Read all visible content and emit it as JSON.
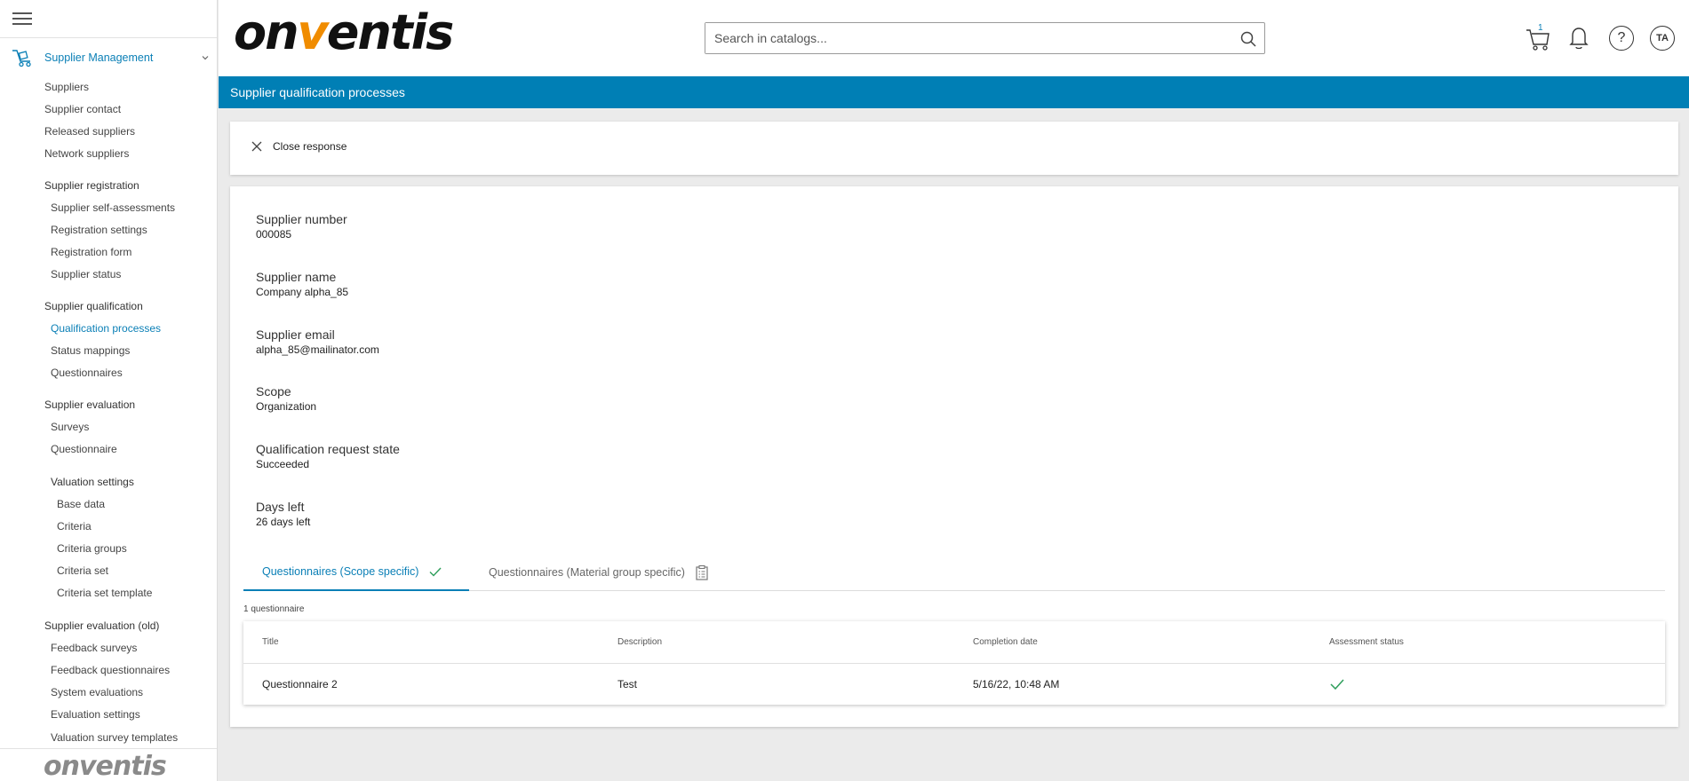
{
  "sidebar": {
    "section_label": "Supplier Management",
    "items": [
      {
        "label": "Suppliers"
      },
      {
        "label": "Supplier contact"
      },
      {
        "label": "Released suppliers"
      },
      {
        "label": "Network suppliers"
      },
      {
        "label": "Supplier registration"
      },
      {
        "label": "Supplier self-assessments"
      },
      {
        "label": "Registration settings"
      },
      {
        "label": "Registration form"
      },
      {
        "label": "Supplier status"
      },
      {
        "label": "Supplier qualification"
      },
      {
        "label": "Qualification processes"
      },
      {
        "label": "Status mappings"
      },
      {
        "label": "Questionnaires"
      },
      {
        "label": "Supplier evaluation"
      },
      {
        "label": "Surveys"
      },
      {
        "label": "Questionnaire"
      },
      {
        "label": "Valuation settings"
      },
      {
        "label": "Base data"
      },
      {
        "label": "Criteria"
      },
      {
        "label": "Criteria groups"
      },
      {
        "label": "Criteria set"
      },
      {
        "label": "Criteria set template"
      },
      {
        "label": "Supplier evaluation (old)"
      },
      {
        "label": "Feedback surveys"
      },
      {
        "label": "Feedback questionnaires"
      },
      {
        "label": "System evaluations"
      },
      {
        "label": "Evaluation settings"
      },
      {
        "label": "Valuation survey templates"
      }
    ],
    "footer_logo": "onventis"
  },
  "header": {
    "logo_left": "on",
    "logo_v": "v",
    "logo_right": "entis",
    "search_placeholder": "Search in catalogs...",
    "cart_count": "1",
    "help_symbol": "?",
    "avatar_initials": "TA"
  },
  "page_title": "Supplier qualification processes",
  "close_label": "Close response",
  "details": [
    {
      "label": "Supplier number",
      "value": "000085"
    },
    {
      "label": "Supplier name",
      "value": "Company alpha_85"
    },
    {
      "label": "Supplier email",
      "value": "alpha_85@mailinator.com"
    },
    {
      "label": "Scope",
      "value": "Organization"
    },
    {
      "label": "Qualification request state",
      "value": "Succeeded"
    },
    {
      "label": "Days left",
      "value": "26 days left"
    }
  ],
  "tabs": [
    {
      "label": "Questionnaires (Scope specific)",
      "icon": "checkmark-icon",
      "active": true
    },
    {
      "label": "Questionnaires (Material group specific)",
      "icon": "clipboard-icon",
      "active": false
    }
  ],
  "table": {
    "count_label": "1 questionnaire",
    "columns": [
      "Title",
      "Description",
      "Completion date",
      "Assessment status"
    ],
    "rows": [
      {
        "title": "Questionnaire 2",
        "description": "Test",
        "completion_date": "5/16/22, 10:48 AM",
        "status_icon": "checkmark-icon"
      }
    ]
  },
  "colors": {
    "accent": "#007fb5",
    "logo_orange": "#f08c00",
    "success": "#2e9e5b"
  }
}
